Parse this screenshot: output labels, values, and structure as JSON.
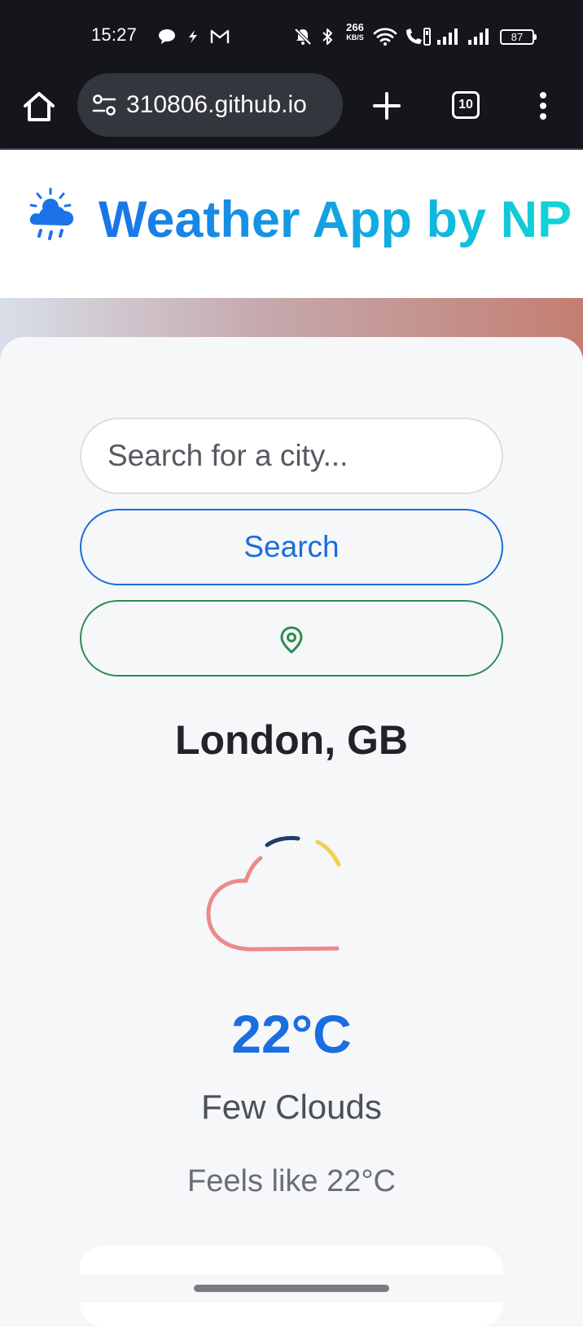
{
  "status_bar": {
    "time": "15:27",
    "net_speed_value": "266",
    "net_speed_unit": "KB/S",
    "battery": "87",
    "icons": [
      "chat-icon",
      "flash-icon",
      "gmail-icon",
      "mute-icon",
      "bluetooth-icon",
      "wifi-icon",
      "volte-call-icon",
      "signal-icon",
      "signal-icon"
    ]
  },
  "browser": {
    "url": "310806.github.io",
    "tab_count": "10",
    "icons": [
      "home-icon",
      "tune-icon",
      "plus-icon",
      "more-vert-icon"
    ]
  },
  "app": {
    "title": "Weather App by NP",
    "logo_icon": "rain-cloud-sun-icon"
  },
  "search": {
    "placeholder": "Search for a city...",
    "value": "",
    "button_label": "Search"
  },
  "location_button": {
    "icon": "location-pin-icon"
  },
  "weather": {
    "city": "London, GB",
    "icon": "few-clouds-icon",
    "temperature": "22°C",
    "condition": "Few Clouds",
    "feels_like": "Feels like 22°C"
  },
  "colors": {
    "accent_blue": "#1a6ed8",
    "location_green": "#2e8b4f",
    "title_gradient_start": "#1a73e8",
    "title_gradient_end": "#12d6d6",
    "cloud_stroke": "#ea8a8a",
    "sun_stroke": "#f0d050",
    "moon_stroke": "#1f3c6a"
  }
}
